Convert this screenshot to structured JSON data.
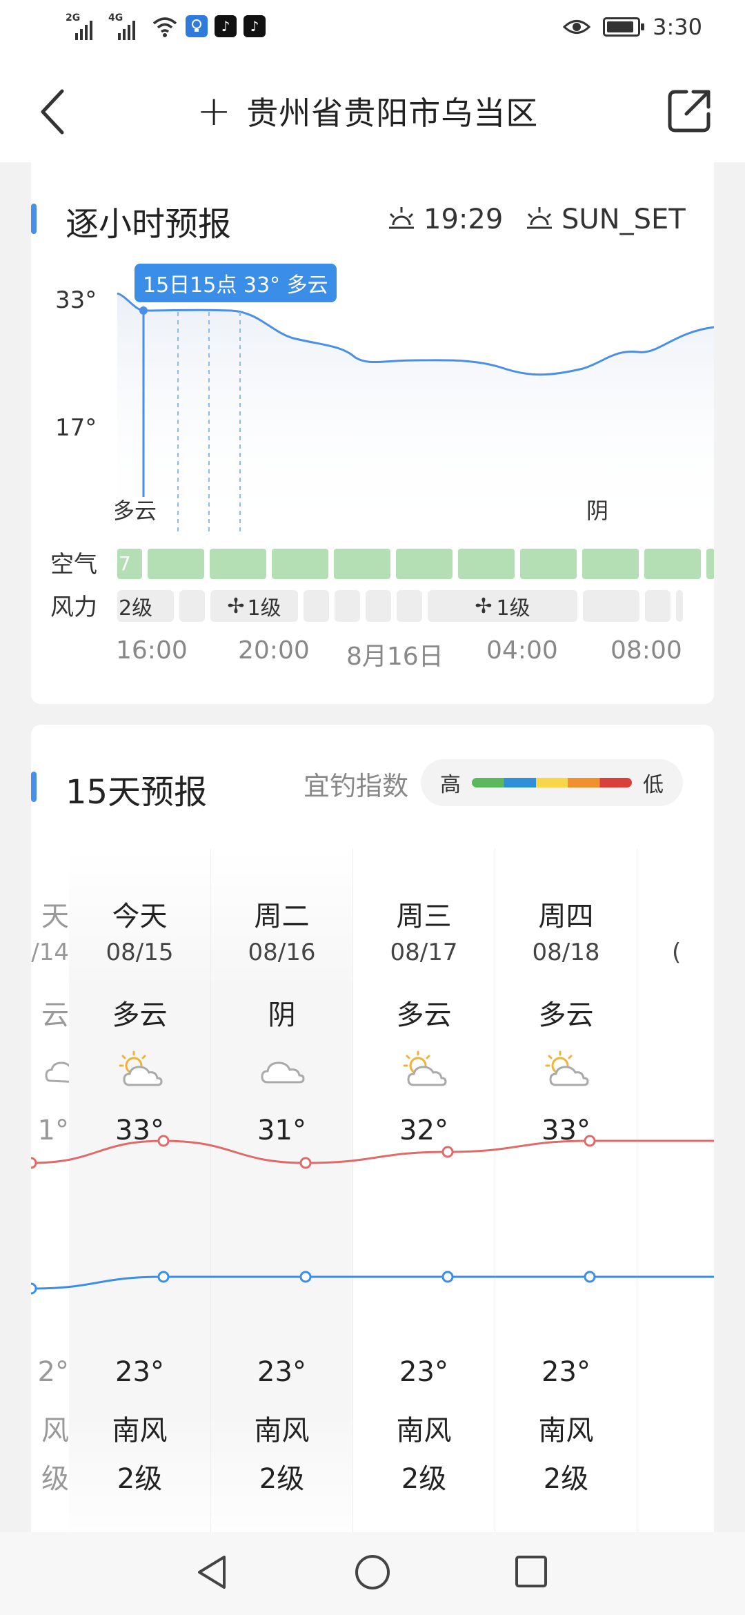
{
  "status_bar": {
    "signal_1": "2G",
    "signal_2": "4G",
    "time": "3:30",
    "icons": [
      "signal-icon",
      "signal-icon",
      "wifi-icon",
      "bulb-app-icon",
      "tiktok-icon",
      "tiktok-icon",
      "eye-icon",
      "battery-icon"
    ]
  },
  "header": {
    "title": "贵州省贵阳市乌当区"
  },
  "hourly": {
    "title": "逐小时预报",
    "sunrise_time": "19:29",
    "sunset_time": "SUN_SET",
    "y_labels": [
      "33°",
      "17°"
    ],
    "tooltip": "15日15点 33° 多云",
    "cond_labels": [
      "多云",
      "阴"
    ],
    "air_label": "空气",
    "wind_label": "风力",
    "air_first": "7",
    "wind_items": [
      "2级",
      "1级",
      "1级"
    ],
    "time_labels": [
      "16:00",
      "20:00",
      "8月16日",
      "04:00",
      "08:00"
    ],
    "accent": "#3b8ee8",
    "air_color": "#b4deb4"
  },
  "daily": {
    "title": "15天预报",
    "fishing_label": "宜钓指数",
    "fishing_high": "高",
    "fishing_low": "低",
    "high_color": "#e06a6a",
    "low_color": "#3b8ee8",
    "days": [
      {
        "day": "天",
        "date": "/14",
        "cond": "云",
        "icon": "partly-cloudy",
        "hi": "1°",
        "lo": "2°",
        "wind_dir": "风",
        "wind_lvl": "级",
        "hi_val": 31,
        "lo_val": 22
      },
      {
        "day": "今天",
        "date": "08/15",
        "cond": "多云",
        "icon": "partly-cloudy",
        "hi": "33°",
        "lo": "23°",
        "wind_dir": "南风",
        "wind_lvl": "2级",
        "hi_val": 33,
        "lo_val": 23
      },
      {
        "day": "周二",
        "date": "08/16",
        "cond": "阴",
        "icon": "cloudy",
        "hi": "31°",
        "lo": "23°",
        "wind_dir": "南风",
        "wind_lvl": "2级",
        "hi_val": 31,
        "lo_val": 23
      },
      {
        "day": "周三",
        "date": "08/17",
        "cond": "多云",
        "icon": "partly-cloudy",
        "hi": "32°",
        "lo": "23°",
        "wind_dir": "南风",
        "wind_lvl": "2级",
        "hi_val": 32,
        "lo_val": 23
      },
      {
        "day": "周四",
        "date": "08/18",
        "cond": "多云",
        "icon": "partly-cloudy",
        "hi": "33°",
        "lo": "23°",
        "wind_dir": "南风",
        "wind_lvl": "2级",
        "hi_val": 33,
        "lo_val": 23
      },
      {
        "day": "",
        "date": "(",
        "cond": "",
        "icon": "",
        "hi": "",
        "lo": "",
        "wind_dir": "",
        "wind_lvl": "",
        "hi_val": 33,
        "lo_val": 23
      }
    ]
  },
  "system_nav": {
    "icons": [
      "back-triangle-icon",
      "home-circle-icon",
      "recents-square-icon"
    ]
  }
}
